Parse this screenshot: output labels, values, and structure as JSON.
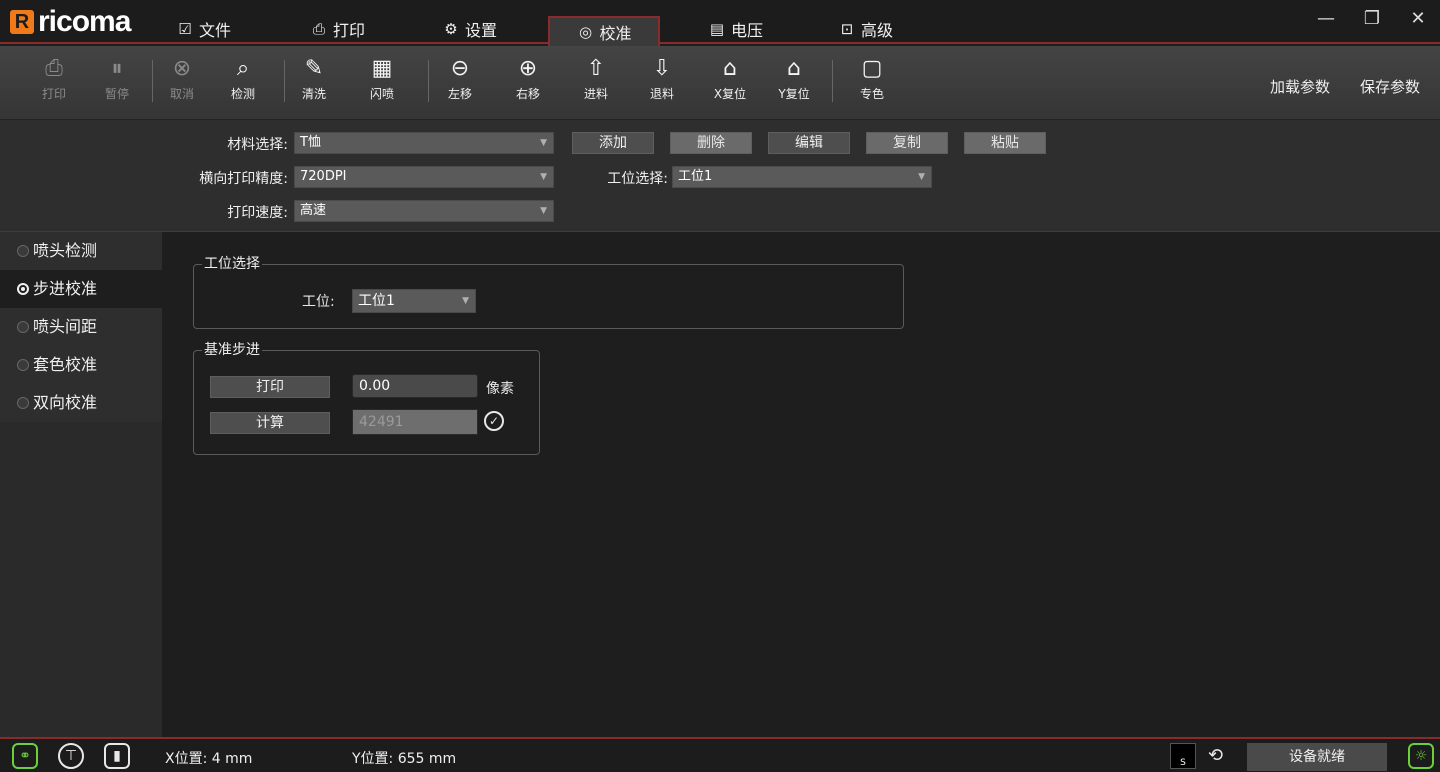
{
  "app": {
    "logo_word": "ricoma",
    "logo_mark": "R"
  },
  "tabs": [
    {
      "label": "文件",
      "icon": "file-check-icon"
    },
    {
      "label": "打印",
      "icon": "printer-icon"
    },
    {
      "label": "设置",
      "icon": "gear-icon"
    },
    {
      "label": "校准",
      "icon": "target-icon"
    },
    {
      "label": "电压",
      "icon": "voltage-icon"
    },
    {
      "label": "高级",
      "icon": "advanced-icon"
    }
  ],
  "active_tab": "校准",
  "toolbar": {
    "print": "打印",
    "pause": "暂停",
    "cancel": "取消",
    "detect": "检测",
    "clean": "清洗",
    "flash": "闪喷",
    "left": "左移",
    "right": "右移",
    "feed": "进料",
    "retract": "退料",
    "x_reset": "X复位",
    "y_reset": "Y复位",
    "spot": "专色",
    "load_params": "加载参数",
    "save_params": "保存参数"
  },
  "settings": {
    "material_label": "材料选择:",
    "material_value": "T恤",
    "dpi_label": "横向打印精度:",
    "dpi_value": "720DPI",
    "speed_label": "打印速度:",
    "speed_value": "高速",
    "station_label": "工位选择:",
    "station_value": "工位1",
    "add": "添加",
    "delete": "删除",
    "edit": "编辑",
    "copy": "复制",
    "paste": "粘贴"
  },
  "sidebar": {
    "items": [
      {
        "label": "喷头检测",
        "selected": false
      },
      {
        "label": "步进校准",
        "selected": true
      },
      {
        "label": "喷头间距",
        "selected": false
      },
      {
        "label": "套色校准",
        "selected": false
      },
      {
        "label": "双向校准",
        "selected": false
      }
    ]
  },
  "station_group": {
    "title": "工位选择",
    "label": "工位:",
    "value": "工位1"
  },
  "base_step_group": {
    "title": "基准步进",
    "print_button": "打印",
    "value": "0.00",
    "unit": "像素",
    "calc_button": "计算",
    "calc_value": "42491"
  },
  "status": {
    "x_pos": "X位置: 4 mm",
    "y_pos": "Y位置: 655 mm",
    "device_state": "设备就绪",
    "ink_label": "S"
  }
}
